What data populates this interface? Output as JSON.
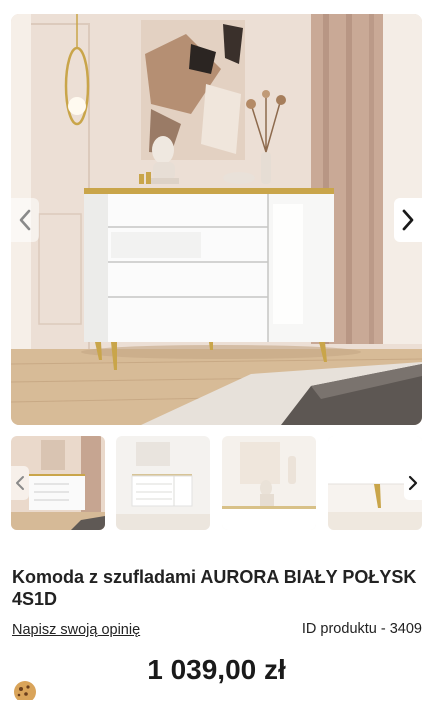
{
  "gallery": {
    "main_image_alt": "Komoda z szufladami AURORA BIAŁY POŁYSK 4S1D",
    "prev_icon": "chevron-left-icon",
    "next_icon": "chevron-right-icon",
    "thumbnail_count": 4
  },
  "product": {
    "title": "Komoda z szufladami AURORA BIAŁY POŁYSK 4S1D",
    "review_link": "Napisz swoją opinię",
    "id_text": "ID produktu - 3409",
    "price": "1 039,00 zł"
  },
  "cookie": {
    "icon": "cookie-icon"
  },
  "colors": {
    "text": "#1a1a1a",
    "accent_gold": "#c9a54a",
    "wall": "#eadfd4"
  }
}
